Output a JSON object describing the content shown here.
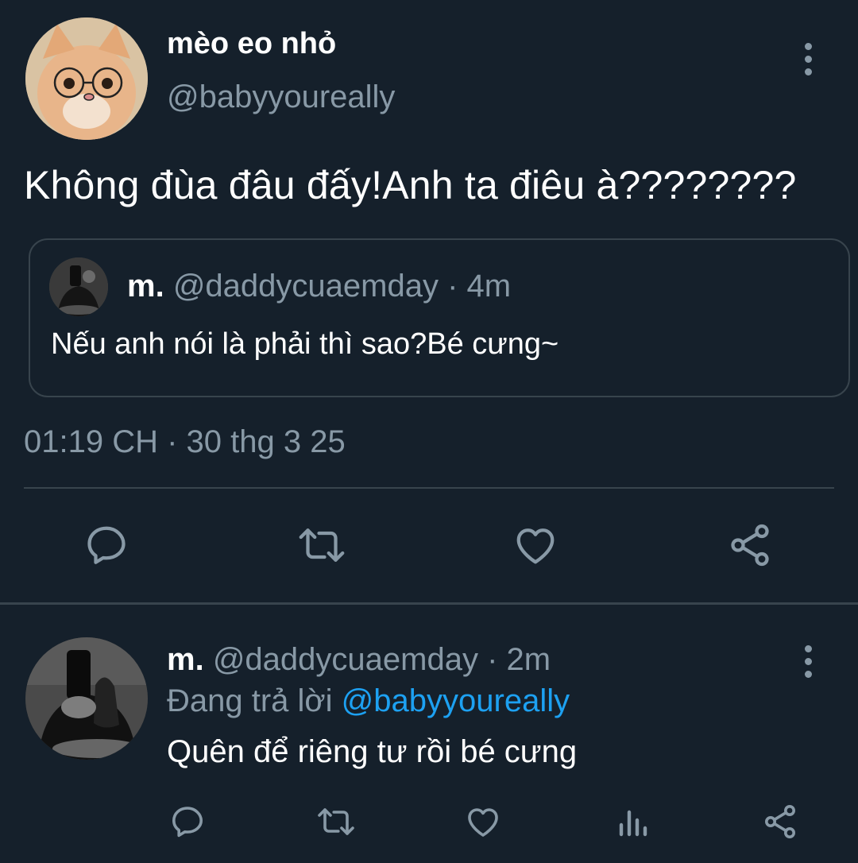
{
  "main_tweet": {
    "display_name": "mèo eo nhỏ",
    "handle": "@babyyoureally",
    "text": "Không đùa đâu đấy!Anh ta điêu à????????",
    "quoted": {
      "display_name": "m.",
      "handle": "@daddycuaemday",
      "separator": "·",
      "time": "4m",
      "text": "Nếu anh nói là phải thì sao?Bé cưng~"
    },
    "timestamp": "01:19 CH · 30 thg 3 25",
    "actions": [
      "reply-icon",
      "retweet-icon",
      "like-icon",
      "share-icon"
    ]
  },
  "reply_tweet": {
    "display_name": "m.",
    "handle": "@daddycuaemday",
    "separator": "·",
    "time": "2m",
    "replying_prefix": "Đang trả lời",
    "replying_to": "@babyyoureally",
    "text": "Quên để riêng tư rồi bé cưng",
    "actions": [
      "reply-icon",
      "retweet-icon",
      "like-icon",
      "analytics-icon",
      "share-icon"
    ]
  },
  "colors": {
    "background": "#15202b",
    "text": "#ffffff",
    "muted": "#8899a6",
    "link": "#1da1f2",
    "border": "#38444d"
  }
}
